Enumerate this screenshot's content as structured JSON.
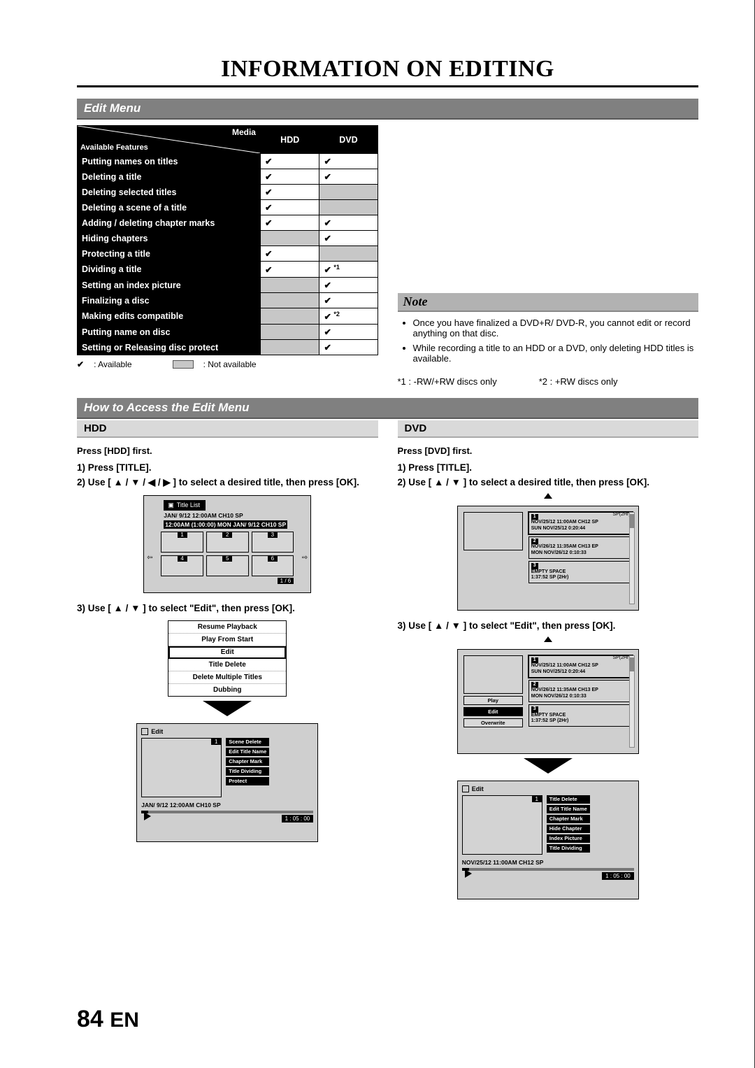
{
  "title": "INFORMATION ON EDITING",
  "section1": "Edit Menu",
  "table": {
    "diag_media": "Media",
    "diag_avail": "Available Features",
    "col_hdd": "HDD",
    "col_dvd": "DVD",
    "rows": [
      {
        "f": "Putting names on titles",
        "h": "✔",
        "d": "✔"
      },
      {
        "f": "Deleting a title",
        "h": "✔",
        "d": "✔"
      },
      {
        "f": "Deleting selected titles",
        "h": "✔",
        "d": ""
      },
      {
        "f": "Deleting a scene of a title",
        "h": "✔",
        "d": ""
      },
      {
        "f": "Adding / deleting chapter marks",
        "h": "✔",
        "d": "✔"
      },
      {
        "f": "Hiding chapters",
        "h": "",
        "d": "✔"
      },
      {
        "f": "Protecting a title",
        "h": "✔",
        "d": ""
      },
      {
        "f": "Dividing a title",
        "h": "✔",
        "d": "✔",
        "dnote": "*1"
      },
      {
        "f": "Setting an index picture",
        "h": "",
        "d": "✔"
      },
      {
        "f": "Finalizing a disc",
        "h": "",
        "d": "✔"
      },
      {
        "f": "Making edits compatible",
        "h": "",
        "d": "✔",
        "dnote": "*2"
      },
      {
        "f": "Putting name on disc",
        "h": "",
        "d": "✔"
      },
      {
        "f": "Setting or Releasing disc protect",
        "h": "",
        "d": "✔"
      }
    ]
  },
  "legend": {
    "chk": "✔",
    "avail": ": Available",
    "na": ": Not available"
  },
  "notes": {
    "head": "Note",
    "items": [
      "Once you have finalized a DVD+R/ DVD-R, you cannot edit or record anything on that disc.",
      "While recording a title to an HDD or a DVD, only deleting HDD titles is available."
    ]
  },
  "footnotes": {
    "f1": "*1 : -RW/+RW discs only",
    "f2": "*2 : +RW discs only"
  },
  "section2": "How to Access the Edit Menu",
  "hdd": {
    "head": "HDD",
    "press_first": "Press [HDD] first.",
    "s1": "1) Press [TITLE].",
    "s2": "2) Use [ ▲ / ▼ / ◀ / ▶ ] to select a desired title, then press [OK].",
    "s3": "3) Use [ ▲ / ▼ ] to select \"Edit\", then press [OK].",
    "title_list": "Title List",
    "line1": "JAN/ 9/12 12:00AM  CH10  SP",
    "line2": "12:00AM (1:00:00)  MON JAN/ 9/12  CH10   SP",
    "page": "1 / 6",
    "menu": [
      "Resume Playback",
      "Play From Start",
      "Edit",
      "Title Delete",
      "Delete Multiple Titles",
      "Dubbing"
    ],
    "edit_head": "Edit",
    "opts": [
      "Scene Delete",
      "Edit Title Name",
      "Chapter Mark",
      "Title Dividing",
      "Protect"
    ],
    "status": "JAN/ 9/12 12:00AM CH10  SP",
    "time": "1 : 05 : 00"
  },
  "dvd": {
    "head": "DVD",
    "press_first": "Press [DVD] first.",
    "s1": "1) Press [TITLE].",
    "s2": "2) Use [ ▲ / ▼ ] to select a desired title, then press [OK].",
    "s3": "3) Use [ ▲ / ▼ ] to select \"Edit\", then press [OK].",
    "sp": "SP(2Hr)",
    "items": [
      {
        "n": "1",
        "l1": "NOV/25/12  11:00AM CH12 SP",
        "l2": "SUN NOV/25/12   0:20:44"
      },
      {
        "n": "2",
        "l1": "NOV/26/12  11:35AM CH13 EP",
        "l2": "MON NOV/26/12   0:10:33"
      },
      {
        "n": "3",
        "l1": "EMPTY SPACE",
        "l2": "1:37:52  SP (2Hr)"
      }
    ],
    "side": {
      "play": "Play",
      "edit": "Edit",
      "ow": "Overwrite"
    },
    "edit_head": "Edit",
    "opts": [
      "Title Delete",
      "Edit Title Name",
      "Chapter Mark",
      "Hide Chapter",
      "Index Picture",
      "Title Dividing"
    ],
    "status": "NOV/25/12 11:00AM CH12 SP",
    "time": "1 : 05 : 00"
  },
  "footer": {
    "pg": "84",
    "lang": "EN"
  }
}
